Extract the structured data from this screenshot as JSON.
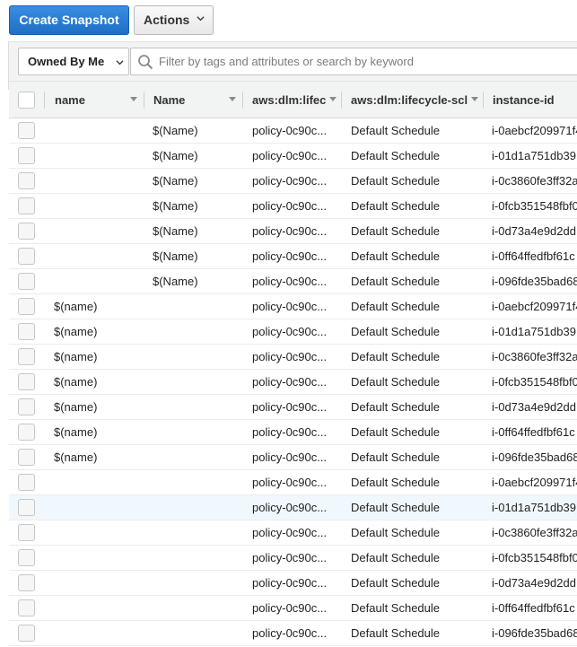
{
  "toolbar": {
    "create_snapshot_label": "Create Snapshot",
    "actions_label": "Actions"
  },
  "filter": {
    "owned_by_label": "Owned By Me",
    "search_placeholder": "Filter by tags and attributes or search by keyword"
  },
  "table": {
    "columns": [
      "name",
      "Name",
      "aws:dlm:lifec",
      "aws:dlm:lifecycle-scl",
      "instance-id"
    ],
    "highlighted_row_index": 15,
    "rows": [
      {
        "name": "",
        "Name": "$(Name)",
        "policy": "policy-0c90c...",
        "schedule": "Default Schedule",
        "instance": "i-0aebcf209971f4"
      },
      {
        "name": "",
        "Name": "$(Name)",
        "policy": "policy-0c90c...",
        "schedule": "Default Schedule",
        "instance": "i-01d1a751db39"
      },
      {
        "name": "",
        "Name": "$(Name)",
        "policy": "policy-0c90c...",
        "schedule": "Default Schedule",
        "instance": "i-0c3860fe3ff32a"
      },
      {
        "name": "",
        "Name": "$(Name)",
        "policy": "policy-0c90c...",
        "schedule": "Default Schedule",
        "instance": "i-0fcb351548fbf0"
      },
      {
        "name": "",
        "Name": "$(Name)",
        "policy": "policy-0c90c...",
        "schedule": "Default Schedule",
        "instance": "i-0d73a4e9d2dd"
      },
      {
        "name": "",
        "Name": "$(Name)",
        "policy": "policy-0c90c...",
        "schedule": "Default Schedule",
        "instance": "i-0ff64ffedfbf61c"
      },
      {
        "name": "",
        "Name": "$(Name)",
        "policy": "policy-0c90c...",
        "schedule": "Default Schedule",
        "instance": "i-096fde35bad68"
      },
      {
        "name": "$(name)",
        "Name": "",
        "policy": "policy-0c90c...",
        "schedule": "Default Schedule",
        "instance": "i-0aebcf209971f4"
      },
      {
        "name": "$(name)",
        "Name": "",
        "policy": "policy-0c90c...",
        "schedule": "Default Schedule",
        "instance": "i-01d1a751db39"
      },
      {
        "name": "$(name)",
        "Name": "",
        "policy": "policy-0c90c...",
        "schedule": "Default Schedule",
        "instance": "i-0c3860fe3ff32a"
      },
      {
        "name": "$(name)",
        "Name": "",
        "policy": "policy-0c90c...",
        "schedule": "Default Schedule",
        "instance": "i-0fcb351548fbf0"
      },
      {
        "name": "$(name)",
        "Name": "",
        "policy": "policy-0c90c...",
        "schedule": "Default Schedule",
        "instance": "i-0d73a4e9d2dd"
      },
      {
        "name": "$(name)",
        "Name": "",
        "policy": "policy-0c90c...",
        "schedule": "Default Schedule",
        "instance": "i-0ff64ffedfbf61c"
      },
      {
        "name": "$(name)",
        "Name": "",
        "policy": "policy-0c90c...",
        "schedule": "Default Schedule",
        "instance": "i-096fde35bad68"
      },
      {
        "name": "",
        "Name": "",
        "policy": "policy-0c90c...",
        "schedule": "Default Schedule",
        "instance": "i-0aebcf209971f4"
      },
      {
        "name": "",
        "Name": "",
        "policy": "policy-0c90c...",
        "schedule": "Default Schedule",
        "instance": "i-01d1a751db39"
      },
      {
        "name": "",
        "Name": "",
        "policy": "policy-0c90c...",
        "schedule": "Default Schedule",
        "instance": "i-0c3860fe3ff32a"
      },
      {
        "name": "",
        "Name": "",
        "policy": "policy-0c90c...",
        "schedule": "Default Schedule",
        "instance": "i-0fcb351548fbf0"
      },
      {
        "name": "",
        "Name": "",
        "policy": "policy-0c90c...",
        "schedule": "Default Schedule",
        "instance": "i-0d73a4e9d2dd"
      },
      {
        "name": "",
        "Name": "",
        "policy": "policy-0c90c...",
        "schedule": "Default Schedule",
        "instance": "i-0ff64ffedfbf61c"
      },
      {
        "name": "",
        "Name": "",
        "policy": "policy-0c90c...",
        "schedule": "Default Schedule",
        "instance": "i-096fde35bad68"
      }
    ]
  },
  "colors": {
    "primary_button": "#1f6fc5",
    "header_bg": "#f2f3f3",
    "row_highlight": "#f1f8fd"
  }
}
